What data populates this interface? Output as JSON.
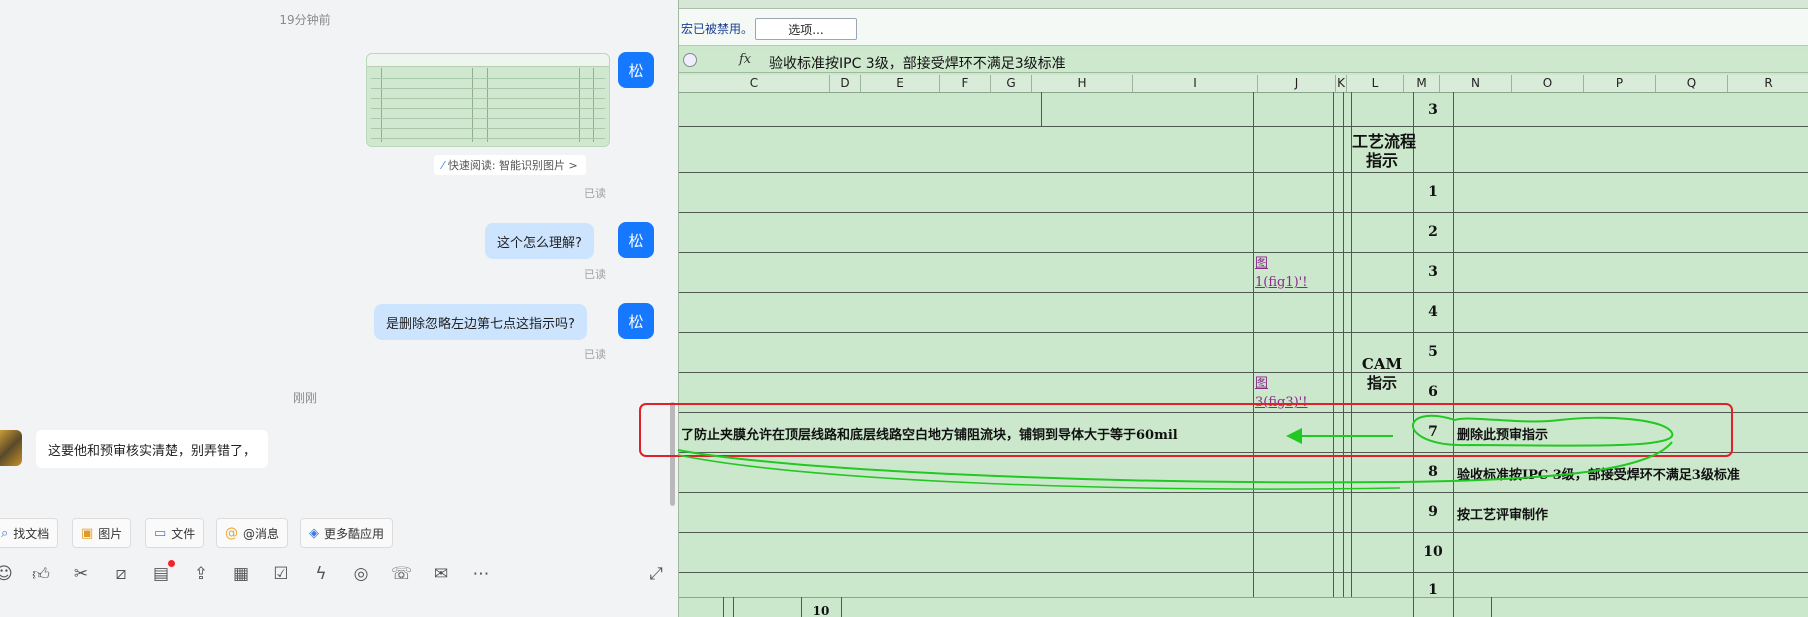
{
  "chat": {
    "timestamp_1": "19分钟前",
    "timestamp_2": "刚刚",
    "user_avatar": "松",
    "quick_read": "快速阅读: 智能识别图片 >",
    "messages": [
      {
        "text": "这个怎么理解?",
        "status": "已读"
      },
      {
        "text": "是删除忽略左边第七点这指示吗?",
        "status": "已读"
      }
    ],
    "image_status": "已读",
    "incoming_message": "这要他和预审核实清楚，别弄错了，",
    "toolbar": [
      {
        "label": "找文档",
        "icon": "search-doc-icon"
      },
      {
        "label": "图片",
        "icon": "image-icon"
      },
      {
        "label": "文件",
        "icon": "folder-icon"
      },
      {
        "label": "@消息",
        "icon": "at-icon"
      },
      {
        "label": "更多酷应用",
        "icon": "apps-icon"
      }
    ],
    "icons": [
      "emoji-icon",
      "thumbs-up-icon",
      "scissors-icon",
      "slash-icon",
      "doc-add-icon",
      "upload-icon",
      "calendar-icon",
      "checkbox-icon",
      "lightning-icon",
      "headset-icon",
      "phone-icon",
      "mail-icon",
      "more-icon",
      "expand-icon"
    ]
  },
  "sheet": {
    "security_message": "宏已被禁用。",
    "options_button": "选项...",
    "fx_symbol": "fx",
    "formula": "验收标准按IPC 3级，部接受焊环不满足3级标准",
    "columns": [
      "C",
      "D",
      "E",
      "F",
      "G",
      "H",
      "I",
      "J",
      "K",
      "L",
      "M",
      "N",
      "O",
      "P",
      "Q",
      "R"
    ],
    "row_numbers": [
      "3",
      "1",
      "2",
      "3",
      "4",
      "5",
      "6",
      "7",
      "8",
      "9",
      "10",
      "1"
    ],
    "bottom_number": "10",
    "process_title": "工艺流程\n指示",
    "cam_label": "CAM\n指示",
    "fig1": "图\n1(fig1)'!",
    "fig3": "图\n3(fig3)'!",
    "row7_left": "了防止夹膜允许在顶层线路和底层线路空白地方铺阻流块，铺铜到导体大于等于60mil",
    "row7_right": "删除此预审指示",
    "row8_right": "验收标准按IPC 3级，部接受焊环不满足3级标准",
    "row9_right": "按工艺评审制作",
    "annotation_colors": {
      "red_box": "#e0202a",
      "green": "#22c822"
    }
  }
}
